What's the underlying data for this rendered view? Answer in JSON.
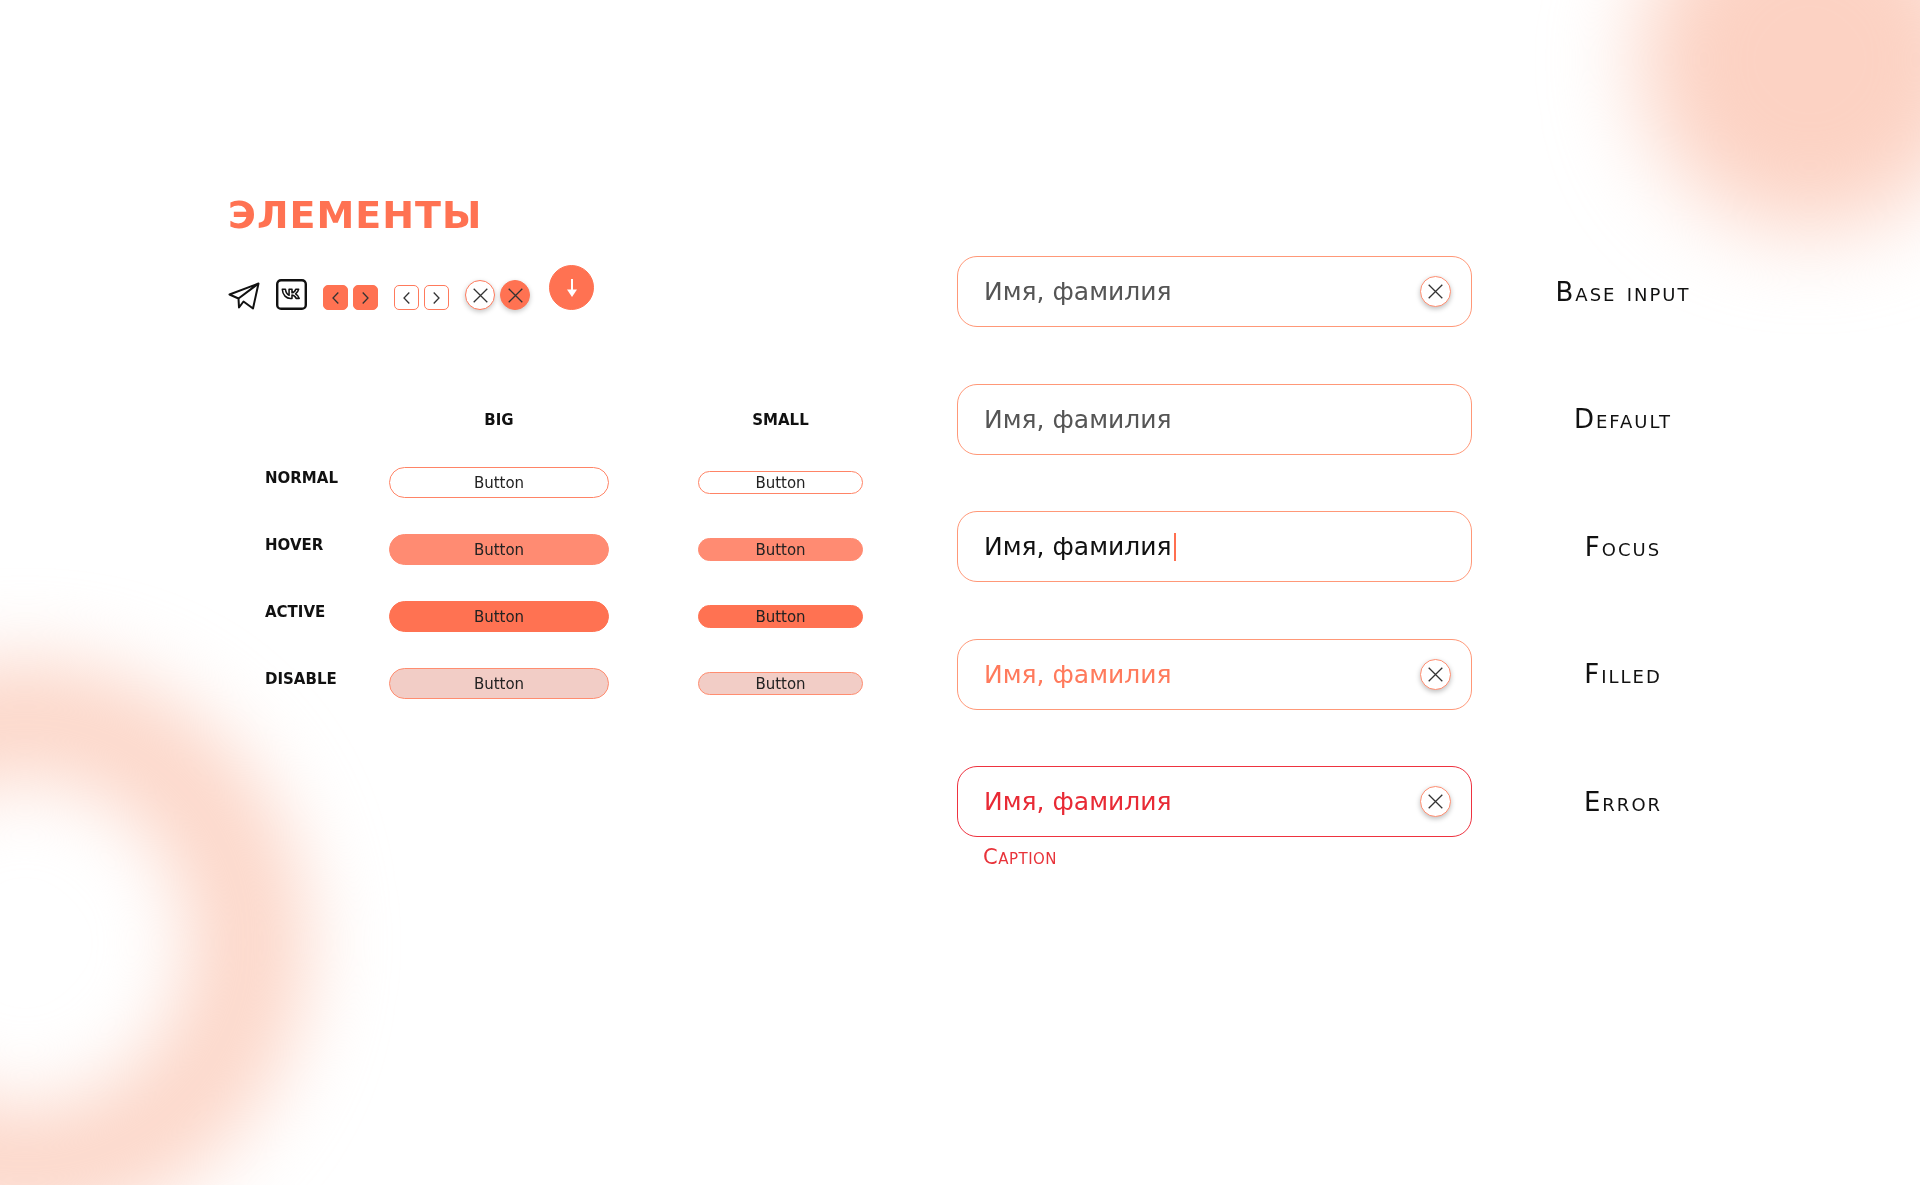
{
  "title": "ЭЛЕМЕНТЫ",
  "icon_groups": [
    [
      {
        "kind": "plane"
      }
    ],
    [
      {
        "kind": "vk"
      }
    ],
    [
      {
        "kind": "prev",
        "filled": true
      },
      {
        "kind": "next",
        "filled": true
      }
    ],
    [
      {
        "kind": "prev",
        "filled": false
      },
      {
        "kind": "next",
        "filled": false
      }
    ],
    [
      {
        "kind": "close",
        "filled": false
      },
      {
        "kind": "close",
        "filled": true
      }
    ],
    [
      {
        "kind": "down",
        "filled": true
      }
    ]
  ],
  "button_table": {
    "columns": [
      {
        "label": "BIG",
        "kind": "big"
      },
      {
        "label": "SMALL",
        "kind": "small"
      }
    ],
    "rows": [
      {
        "label": "NORMAL",
        "kind": "normal",
        "buttons": [
          "Button",
          "Button"
        ]
      },
      {
        "label": "HOVER",
        "kind": "hover",
        "buttons": [
          "Button",
          "Button"
        ]
      },
      {
        "label": "ACTIVE",
        "kind": "active",
        "buttons": [
          "Button",
          "Button"
        ]
      },
      {
        "label": "DISABLE",
        "kind": "disabled",
        "buttons": [
          "Button",
          "Button"
        ]
      }
    ]
  },
  "inputs": [
    {
      "kind": "base",
      "placeholder": "Имя, фамилия",
      "clear_button": true,
      "focused": false,
      "label": "Base input"
    },
    {
      "kind": "default",
      "placeholder": "Имя, фамилия",
      "clear_button": false,
      "focused": false,
      "label": "Default"
    },
    {
      "kind": "focus",
      "value": "Имя, фамилия",
      "clear_button": false,
      "focused": true,
      "label": "Focus"
    },
    {
      "kind": "filled",
      "value": "Имя, фамилия",
      "clear_button": true,
      "focused": false,
      "label": "Filled"
    },
    {
      "kind": "error",
      "value": "Имя, фамилия",
      "clear_button": true,
      "focused": false,
      "label": "Error",
      "caption": "Caption"
    }
  ]
}
